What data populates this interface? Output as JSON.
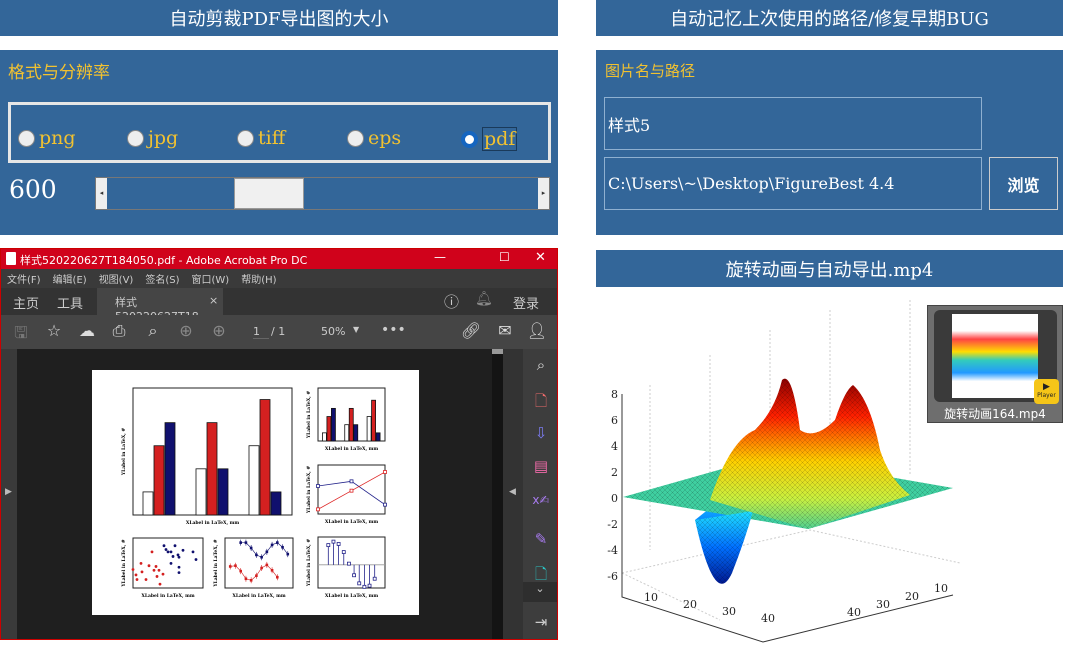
{
  "left_panel": {
    "header": "自动剪裁PDF导出图的大小",
    "section_label": "格式与分辨率",
    "formats": [
      {
        "label": "png",
        "selected": false
      },
      {
        "label": "jpg",
        "selected": false
      },
      {
        "label": "tiff",
        "selected": false
      },
      {
        "label": "eps",
        "selected": false
      },
      {
        "label": "pdf",
        "selected": true
      }
    ],
    "resolution": "600",
    "slider_fraction": 0.35
  },
  "right_panel": {
    "header": "自动记忆上次使用的路径/修复早期BUG",
    "section_label": "图片名与路径",
    "name_value": "样式5",
    "path_value": "C:\\Users\\~\\Desktop\\FigureBest 4.4",
    "browse_label": "浏览"
  },
  "acrobat": {
    "title": "样式520220627T184050.pdf - Adobe Acrobat Pro DC",
    "menu": [
      "文件(F)",
      "编辑(E)",
      "视图(V)",
      "签名(S)",
      "窗口(W)",
      "帮助(H)"
    ],
    "tabs": {
      "home": "主页",
      "tools": "工具",
      "doc": "样式520220627T18...",
      "login": "登录"
    },
    "page_current": "1",
    "page_total": "/ 1",
    "zoom": "50%",
    "xlabel": "XLabel in LaTeX, mm",
    "ylabel": "YLabel in LaTeX, #",
    "bars": [
      [
        1,
        3,
        4
      ],
      [
        2,
        4,
        2
      ],
      [
        3,
        5,
        1
      ]
    ],
    "line_blue": [
      6,
      7,
      2
    ],
    "line_red": [
      1,
      5,
      9
    ],
    "scatter_red": [
      [
        -2,
        0.4
      ],
      [
        -1.7,
        -0.3
      ],
      [
        -1.6,
        -0.9
      ],
      [
        -1.2,
        1.2
      ],
      [
        -1.1,
        0.1
      ],
      [
        -0.7,
        -0.9
      ],
      [
        -0.4,
        0.9
      ],
      [
        -0.1,
        2.7
      ],
      [
        0.1,
        0.3
      ],
      [
        0.3,
        0.8
      ],
      [
        0.4,
        -0.5
      ],
      [
        0.6,
        0.3
      ],
      [
        0.7,
        -1.5
      ],
      [
        1,
        -0.2
      ]
    ],
    "scatter_blue": [
      [
        1.1,
        3.5
      ],
      [
        1.3,
        3
      ],
      [
        1.5,
        2.7
      ],
      [
        1.8,
        2.7
      ],
      [
        1.8,
        1.2
      ],
      [
        2,
        2.1
      ],
      [
        2.2,
        3.5
      ],
      [
        2.5,
        2.3
      ],
      [
        2.6,
        2
      ],
      [
        2.6,
        0.7
      ],
      [
        2.6,
        0
      ],
      [
        3,
        2.9
      ],
      [
        4,
        2.7
      ],
      [
        4.3,
        1.7
      ]
    ],
    "err_blue": [
      [
        3,
        3.9
      ],
      [
        4,
        3.9
      ],
      [
        5,
        3.2
      ],
      [
        6,
        2.3
      ],
      [
        7,
        2
      ],
      [
        8,
        2.7
      ],
      [
        9,
        3.6
      ],
      [
        10,
        3.9
      ],
      [
        11,
        3.3
      ],
      [
        12,
        2.4
      ]
    ],
    "err_red": [
      [
        1,
        0.8
      ],
      [
        2,
        0.9
      ],
      [
        3,
        0.2
      ],
      [
        4,
        -0.8
      ],
      [
        5,
        -1
      ],
      [
        6,
        -0.4
      ],
      [
        7,
        0.6
      ],
      [
        8,
        1
      ],
      [
        9,
        0.3
      ],
      [
        10,
        -0.6
      ]
    ],
    "stems": [
      [
        1,
        0.85
      ],
      [
        1.5,
        1
      ],
      [
        2,
        0.9
      ],
      [
        2.5,
        0.55
      ],
      [
        3,
        0.05
      ],
      [
        3.5,
        -0.45
      ],
      [
        4,
        -0.8
      ],
      [
        4.5,
        -0.95
      ],
      [
        5,
        -0.9
      ],
      [
        5.5,
        -0.6
      ]
    ]
  },
  "animation": {
    "header": "旋转动画与自动导出.mp4",
    "video_name": "旋转动画164.mp4",
    "player_label": "Player",
    "z_ticks": [
      "8",
      "6",
      "4",
      "2",
      "0",
      "-2",
      "-4",
      "-6"
    ],
    "x_ticks": [
      "10",
      "20",
      "30",
      "40"
    ],
    "y_ticks": [
      "10",
      "20",
      "30",
      "40"
    ]
  },
  "colors": {
    "panel": "#336699",
    "label": "#f2c230",
    "acrobat_red": "#d0021b"
  }
}
